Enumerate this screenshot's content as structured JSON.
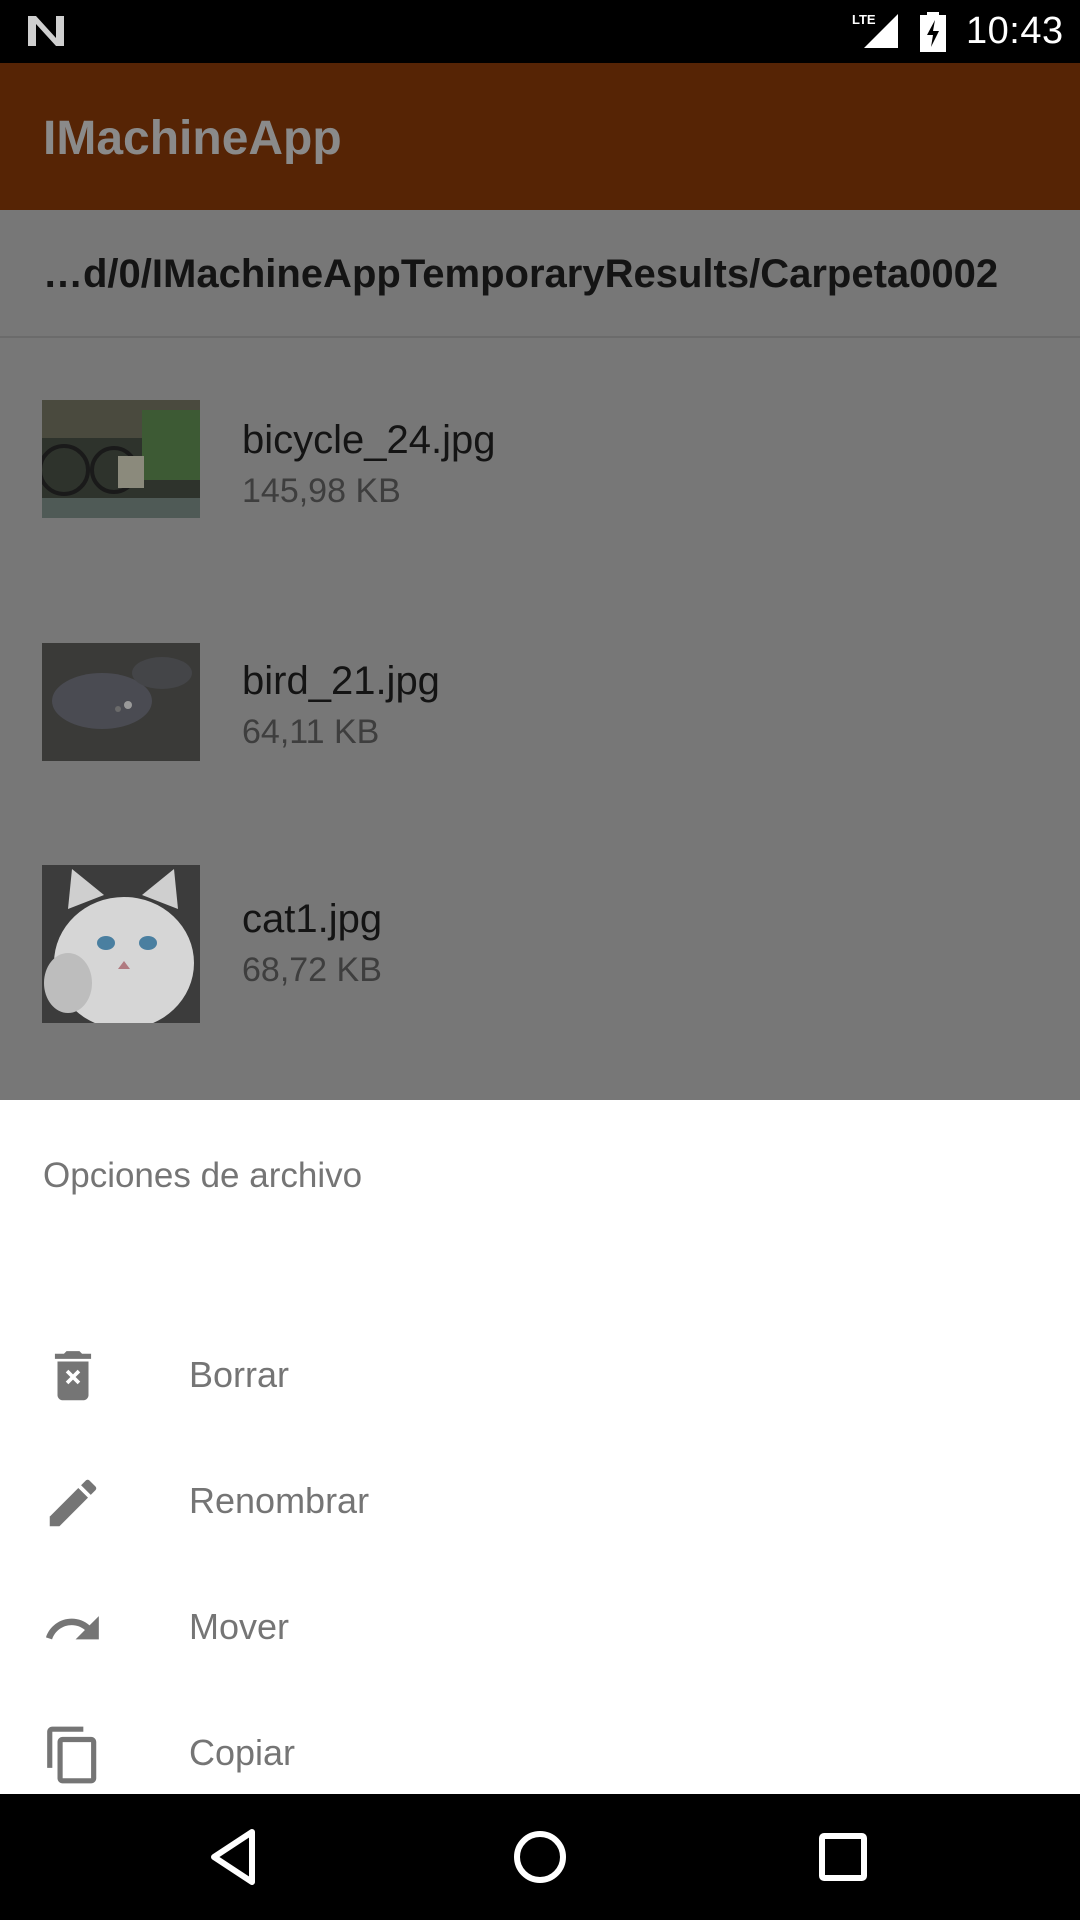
{
  "status_bar": {
    "time": "10:43",
    "network": "LTE"
  },
  "app_bar": {
    "title": "IMachineApp"
  },
  "path": "…d/0/IMachineAppTemporaryResults/Carpeta0002",
  "files": [
    {
      "name": "bicycle_24.jpg",
      "size": "145,98 KB"
    },
    {
      "name": "bird_21.jpg",
      "size": "64,11 KB"
    },
    {
      "name": "cat1.jpg",
      "size": "68,72 KB"
    }
  ],
  "sheet": {
    "title": "Opciones de archivo",
    "options": [
      {
        "label": "Borrar",
        "icon": "delete-icon"
      },
      {
        "label": "Renombrar",
        "icon": "edit-icon"
      },
      {
        "label": "Mover",
        "icon": "redo-icon"
      },
      {
        "label": "Copiar",
        "icon": "copy-icon"
      }
    ]
  },
  "colors": {
    "app_bar": "#562405",
    "scrim_content": "#777777",
    "sheet_text": "#757575"
  }
}
